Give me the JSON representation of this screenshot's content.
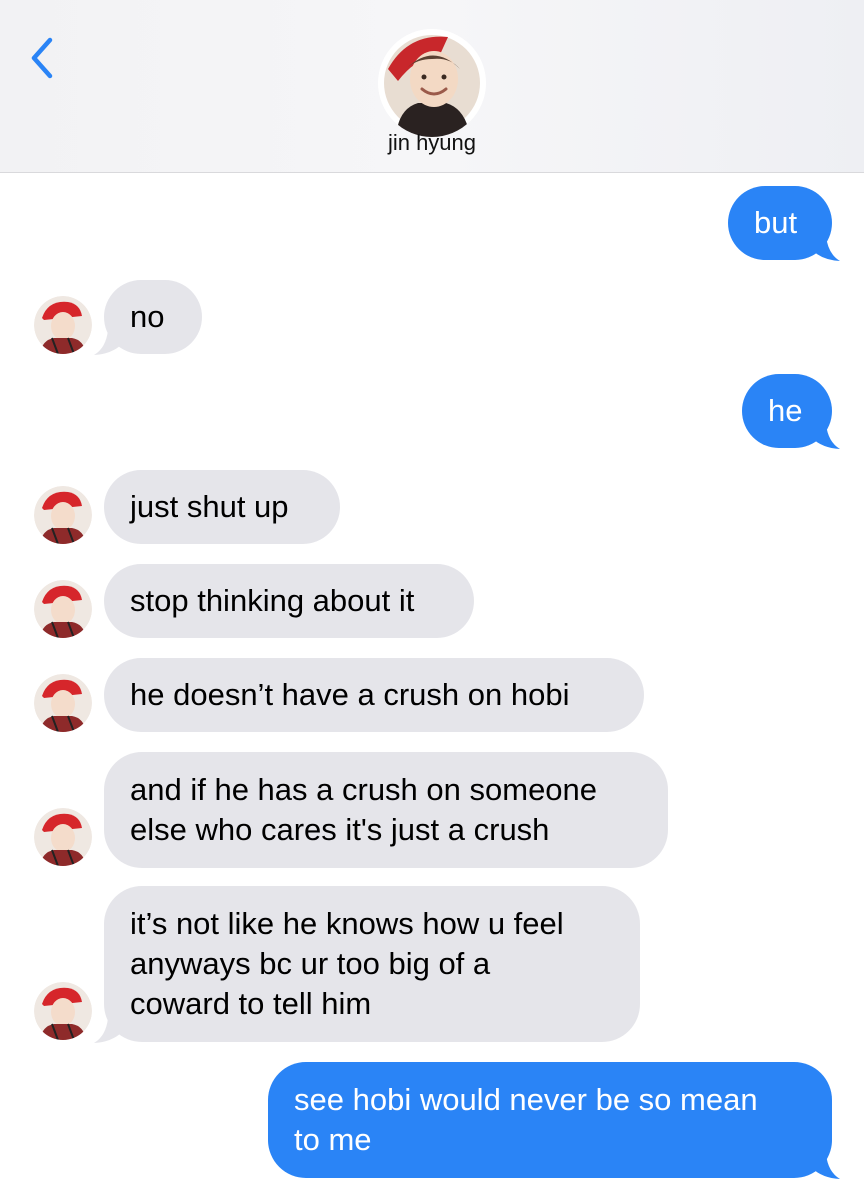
{
  "header": {
    "back_label": "<",
    "contact_name": "jin hyung",
    "avatar_icon": "contact-photo-icon"
  },
  "colors": {
    "outgoing": "#2a84f6",
    "incoming": "#e5e5ea",
    "accent": "#2a84f6"
  },
  "messages": [
    {
      "from": "me",
      "text": "but"
    },
    {
      "from": "them",
      "text": "no"
    },
    {
      "from": "me",
      "text": "he"
    },
    {
      "from": "them",
      "text": "just shut up"
    },
    {
      "from": "them",
      "text": "stop thinking about it"
    },
    {
      "from": "them",
      "text": "he doesn’t have a crush on hobi"
    },
    {
      "from": "them",
      "text": "and if he has a crush on someone\nelse who cares it's just a crush"
    },
    {
      "from": "them",
      "text": "it’s not like he knows how u feel\nanyways bc ur too big of a\ncoward to tell him"
    },
    {
      "from": "me",
      "text": "see hobi would never be so mean\nto me"
    }
  ]
}
